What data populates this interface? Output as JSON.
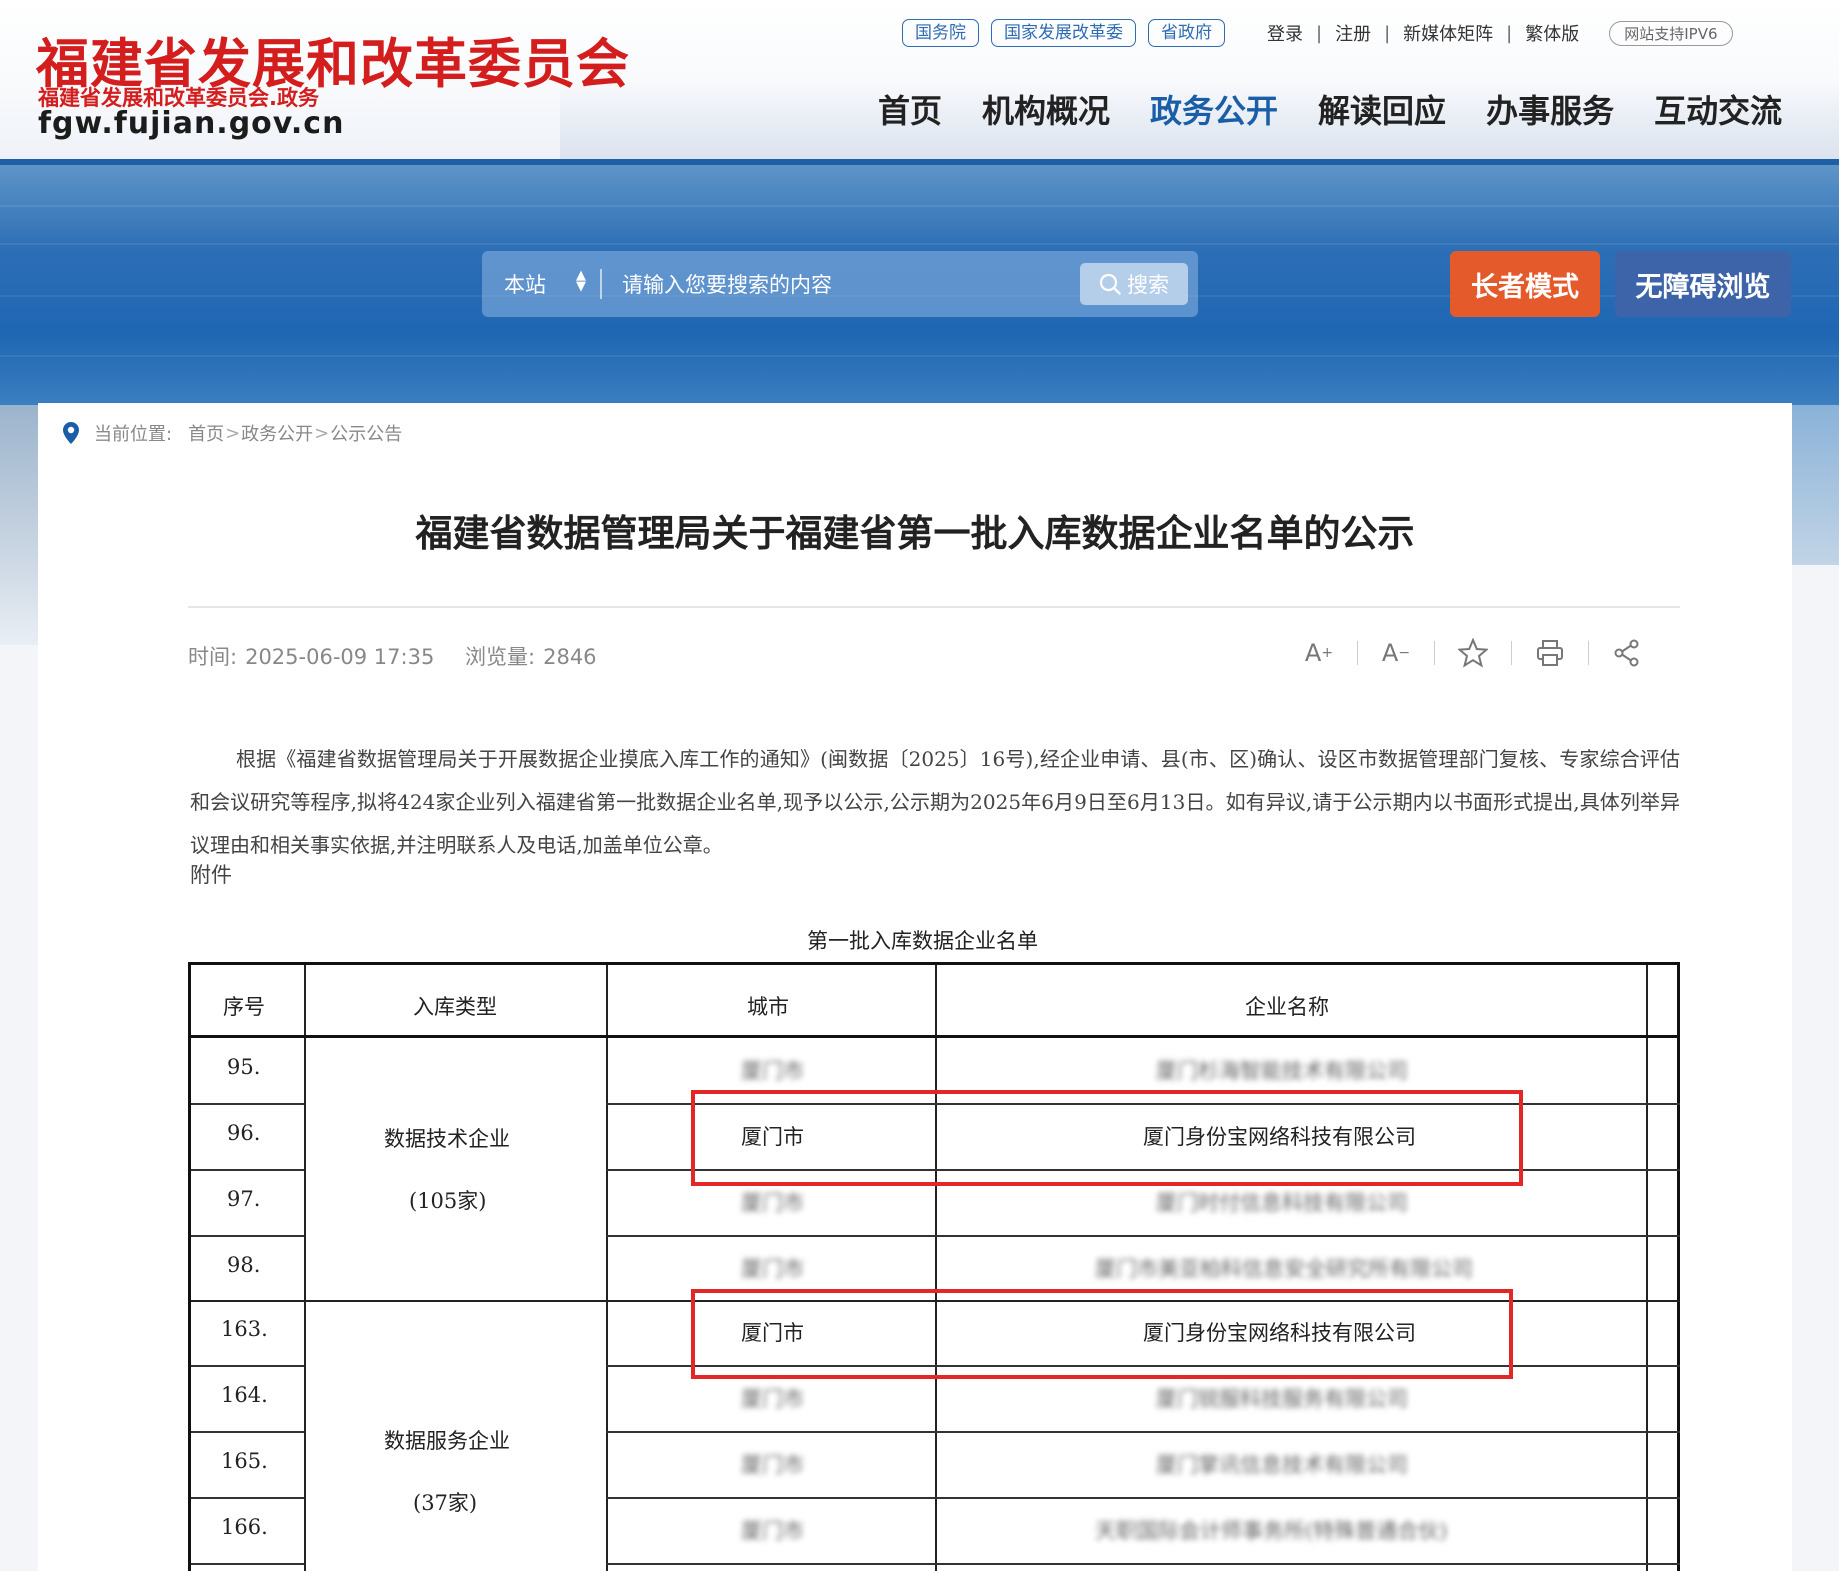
{
  "site": {
    "title": "福建省发展和改革委员会",
    "subtitle": "福建省发展和改革委员会.政务",
    "url": "fgw.fujian.gov.cn"
  },
  "toplinks": {
    "pills": [
      "国务院",
      "国家发展改革委",
      "省政府"
    ],
    "plain": [
      "登录",
      "注册",
      "新媒体矩阵",
      "繁体版"
    ],
    "ipv6": "网站支持IPV6"
  },
  "nav": [
    "首页",
    "机构概况",
    "政务公开",
    "解读回应",
    "办事服务",
    "互动交流"
  ],
  "nav_active": "政务公开",
  "search": {
    "scope": "本站",
    "placeholder": "请输入您要搜索的内容",
    "button": "搜索"
  },
  "modes": {
    "elder": "长者模式",
    "accessible": "无障碍浏览"
  },
  "breadcrumb": {
    "label": "当前位置:",
    "items": [
      "首页",
      "政务公开",
      "公示公告"
    ]
  },
  "article": {
    "title": "福建省数据管理局关于福建省第一批入库数据企业名单的公示",
    "time_label": "时间:",
    "time": "2025-06-09 17:35",
    "views_label": "浏览量:",
    "views": "2846",
    "body": "根据《福建省数据管理局关于开展数据企业摸底入库工作的通知》(闽数据〔2025〕16号),经企业申请、县(市、区)确认、设区市数据管理部门复核、专家综合评估和会议研究等程序,拟将424家企业列入福建省第一批数据企业名单,现予以公示,公示期为2025年6月9日至6月13日。如有异议,请于公示期内以书面形式提出,具体列举异议理由和相关事实依据,并注明联系人及电话,加盖单位公章。",
    "attachment": "附件"
  },
  "table": {
    "title": "第一批入库数据企业名单",
    "headers": [
      "序号",
      "入库类型",
      "城市",
      "企业名称"
    ],
    "groups": [
      {
        "type": "数据技术企业",
        "count": "(105家)"
      },
      {
        "type": "数据服务企业",
        "count": "(37家)"
      }
    ],
    "rows": [
      {
        "no": "95.",
        "city": "厦门市",
        "company": "厦门杉海智能技术有限公司",
        "blurred": true
      },
      {
        "no": "96.",
        "city": "厦门市",
        "company": "厦门身份宝网络科技有限公司",
        "blurred": false
      },
      {
        "no": "97.",
        "city": "厦门市",
        "company": "厦门时付信息科技有限公司",
        "blurred": true
      },
      {
        "no": "98.",
        "city": "厦门市",
        "company": "厦门市美亚柏科信息安全研究所有限公司",
        "blurred": true
      },
      {
        "no": "163.",
        "city": "厦门市",
        "company": "厦门身份宝网络科技有限公司",
        "blurred": false
      },
      {
        "no": "164.",
        "city": "厦门市",
        "company": "厦门锐服科技服务有限公司",
        "blurred": true
      },
      {
        "no": "165.",
        "city": "厦门市",
        "company": "厦门掌讯信息技术有限公司",
        "blurred": true
      },
      {
        "no": "166.",
        "city": "厦门市",
        "company": "天职国际会计师事务所(特殊普通合伙)",
        "blurred": true
      }
    ]
  },
  "colors": {
    "brand_red": "#d41d1d",
    "nav_active": "#1a5ea8",
    "elder_btn": "#e55a2b",
    "access_btn": "#3d64a8",
    "highlight": "#e32626"
  }
}
